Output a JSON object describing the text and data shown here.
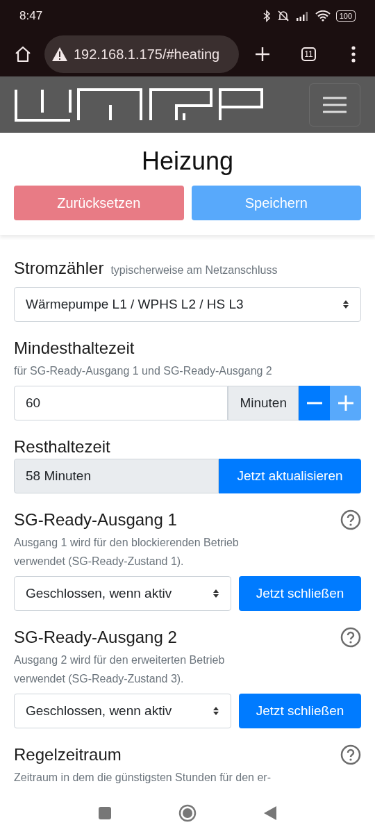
{
  "status_bar": {
    "time": "8:47",
    "battery": "100"
  },
  "browser": {
    "url": "192.168.1.175/#heating",
    "tab_count": "11"
  },
  "page": {
    "title": "Heizung",
    "buttons": [
      {
        "label": "Zurücksetzen",
        "kind": "reset"
      },
      {
        "label": "Speichern",
        "kind": "save"
      }
    ],
    "sections": [
      {
        "kind": "select",
        "title": "Stromzähler",
        "hint": "typischerweise am Netzanschluss",
        "value": "Wärmepumpe L1 / WPHS L2 / HS L3"
      },
      {
        "kind": "number",
        "title": "Mindesthaltezeit",
        "description": "für SG-Ready-Ausgang 1 und SG-Ready-Ausgang 2",
        "value": "60",
        "unit": "Minuten"
      },
      {
        "kind": "readonly",
        "title": "Resthaltezeit",
        "value": "58 Minuten",
        "button": "Jetzt aktualisieren"
      },
      {
        "kind": "output",
        "title": "SG-Ready-Ausgang 1",
        "help": true,
        "description": "Ausgang 1 wird für den blockierenden Betrieb verwendet (SG-Ready-Zustand 1).",
        "value": "Geschlossen, wenn aktiv",
        "button": "Jetzt schließen"
      },
      {
        "kind": "output",
        "title": "SG-Ready-Ausgang 2",
        "help": true,
        "description": "Ausgang 2 wird für den erweiterten Betrieb verwendet (SG-Ready-Zustand 3).",
        "value": "Geschlossen, wenn aktiv",
        "button": "Jetzt schließen"
      },
      {
        "kind": "heading",
        "title": "Regelzeitraum",
        "help": true,
        "description": "Zeitraum in dem die günstigsten Stunden für den er-"
      }
    ]
  }
}
